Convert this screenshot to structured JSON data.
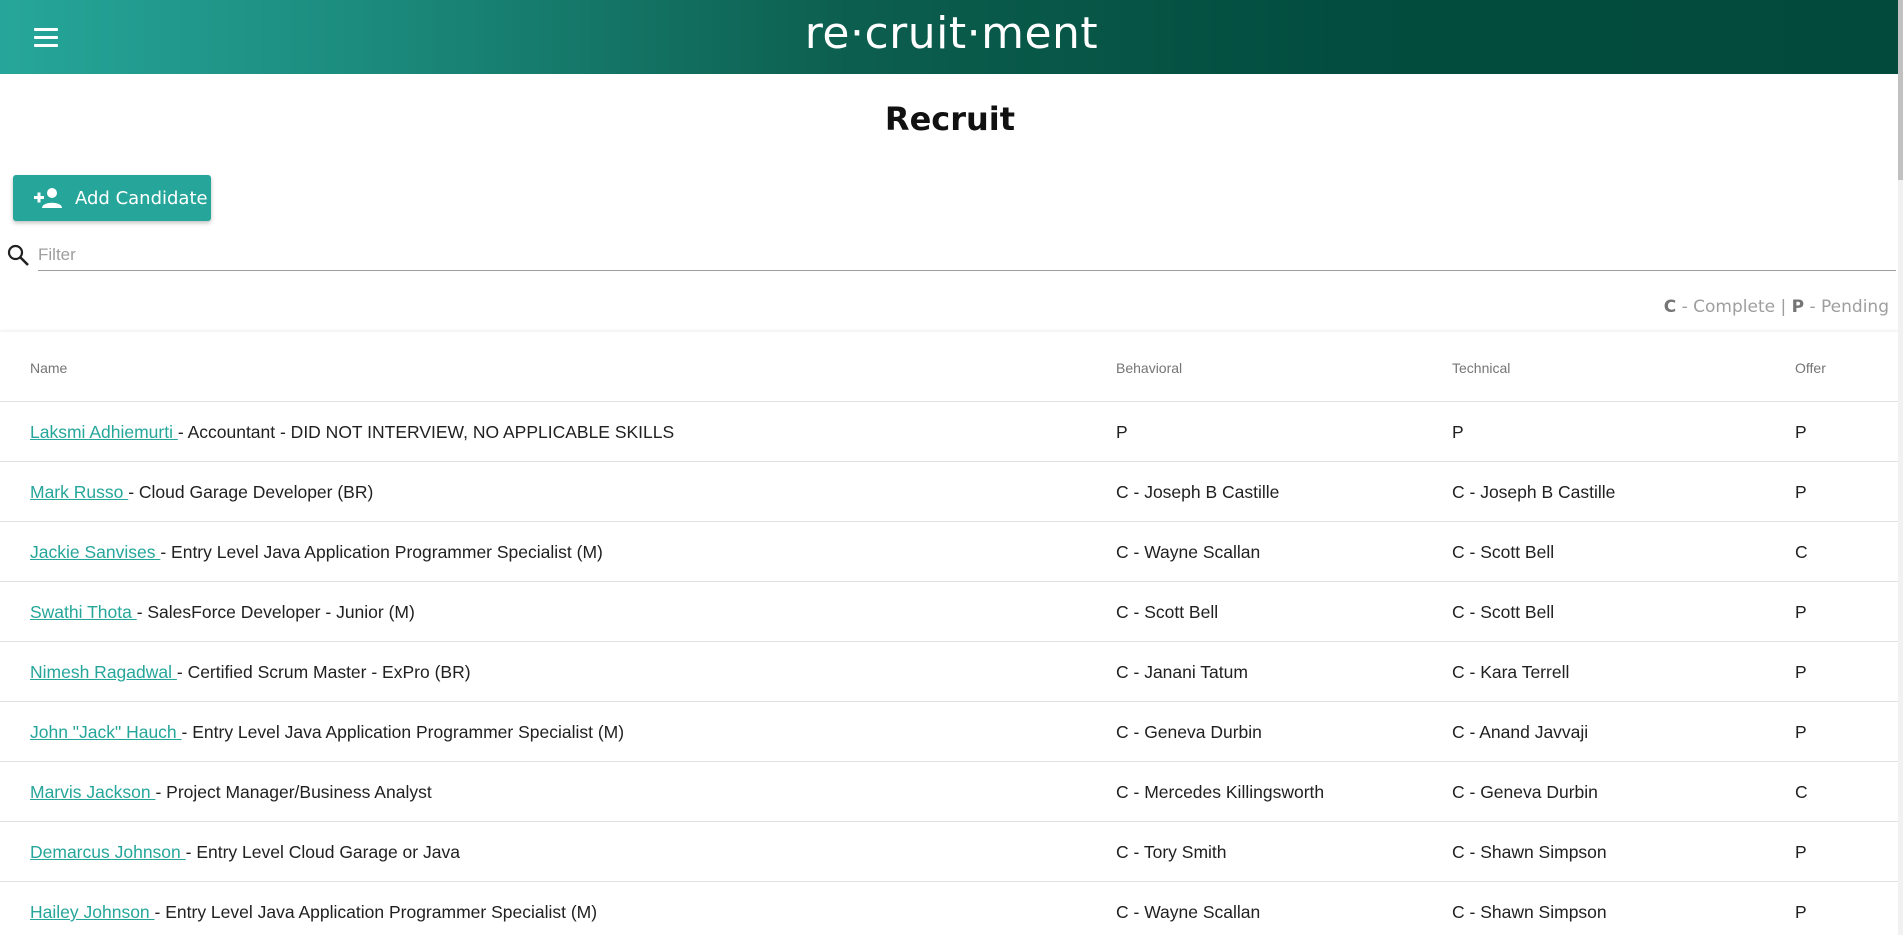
{
  "header": {
    "brand": "re·cruit·ment",
    "menu_icon": "menu-icon"
  },
  "page": {
    "title": "Recruit"
  },
  "toolbar": {
    "add_label": "Add Candidate",
    "add_icon": "person-add-icon"
  },
  "filter": {
    "placeholder": "Filter",
    "value": "",
    "icon": "search-icon"
  },
  "legend": {
    "c_key": "C",
    "c_text": " - Complete",
    "sep": " | ",
    "p_key": "P",
    "p_text": " - Pending"
  },
  "table": {
    "columns": {
      "name": "Name",
      "behavioral": "Behavioral",
      "technical": "Technical",
      "offer": "Offer"
    },
    "rows": [
      {
        "name": "Laksmi Adhiemurti ",
        "role": " - Accountant - DID NOT INTERVIEW, NO APPLICABLE SKILLS",
        "behavioral": "P",
        "technical": "P",
        "offer": "P"
      },
      {
        "name": "Mark Russo ",
        "role": " - Cloud Garage Developer (BR)",
        "behavioral": "C - Joseph B Castille",
        "technical": "C - Joseph B Castille",
        "offer": "P"
      },
      {
        "name": "Jackie Sanvises ",
        "role": " - Entry Level Java Application Programmer Specialist (M)",
        "behavioral": "C - Wayne Scallan",
        "technical": "C - Scott Bell",
        "offer": "C"
      },
      {
        "name": "Swathi Thota ",
        "role": " - SalesForce Developer - Junior (M)",
        "behavioral": "C - Scott Bell",
        "technical": "C - Scott Bell",
        "offer": "P"
      },
      {
        "name": "Nimesh Ragadwal ",
        "role": " - Certified Scrum Master - ExPro (BR)",
        "behavioral": "C - Janani Tatum",
        "technical": "C - Kara Terrell",
        "offer": "P"
      },
      {
        "name": "John \"Jack\" Hauch ",
        "role": " - Entry Level Java Application Programmer Specialist (M)",
        "behavioral": "C - Geneva Durbin",
        "technical": "C - Anand Javvaji",
        "offer": "P"
      },
      {
        "name": "Marvis Jackson ",
        "role": " - Project Manager/Business Analyst",
        "behavioral": "C - Mercedes Killingsworth",
        "technical": "C - Geneva Durbin",
        "offer": "C"
      },
      {
        "name": "Demarcus Johnson ",
        "role": " - Entry Level Cloud Garage or Java",
        "behavioral": "C - Tory Smith",
        "technical": "C - Shawn Simpson",
        "offer": "P"
      },
      {
        "name": "Hailey Johnson ",
        "role": " - Entry Level Java Application Programmer Specialist (M)",
        "behavioral": "C - Wayne Scallan",
        "technical": "C - Shawn Simpson",
        "offer": "P"
      }
    ]
  },
  "colors": {
    "accent": "#26a69a",
    "header_dark": "#024d3f"
  }
}
